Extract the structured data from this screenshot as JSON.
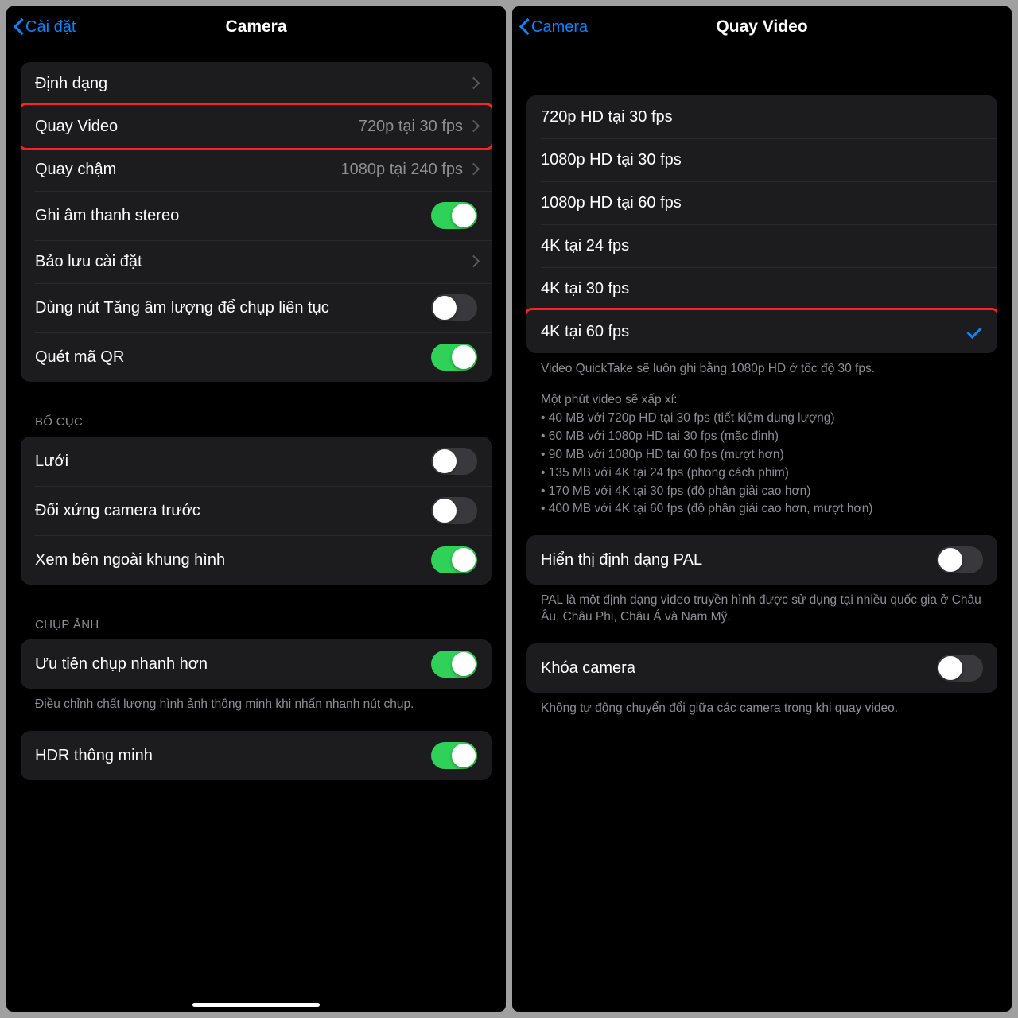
{
  "left": {
    "back": "Cài đặt",
    "title": "Camera",
    "rows": {
      "format": "Định dạng",
      "recordVideo": "Quay Video",
      "recordVideoDetail": "720p tại 30 fps",
      "slowMo": "Quay chậm",
      "slowMoDetail": "1080p tại 240 fps",
      "stereo": "Ghi âm thanh stereo",
      "preserve": "Bảo lưu cài đặt",
      "volumeBurst": "Dùng nút Tăng âm lượng để chụp liên tục",
      "qr": "Quét mã QR"
    },
    "compositionHeader": "BỐ CỤC",
    "composition": {
      "grid": "Lưới",
      "mirror": "Đối xứng camera trước",
      "outside": "Xem bên ngoài khung hình"
    },
    "captureHeader": "CHỤP ẢNH",
    "capture": {
      "fastShot": "Ưu tiên chụp nhanh hơn",
      "fastShotFooter": "Điều chỉnh chất lượng hình ảnh thông minh khi nhấn nhanh nút chụp.",
      "hdr": "HDR thông minh"
    }
  },
  "right": {
    "back": "Camera",
    "title": "Quay Video",
    "options": [
      "720p HD tại 30 fps",
      "1080p HD tại 30 fps",
      "1080p HD tại 60 fps",
      "4K tại 24 fps",
      "4K tại 30 fps",
      "4K tại 60 fps"
    ],
    "quicktake": "Video QuickTake sẽ luôn ghi bằng 1080p HD ở tốc độ 30 fps.",
    "approx": "Một phút video sẽ xấp xỉ:",
    "sizes": [
      "• 40 MB với 720p HD tại 30 fps (tiết kiệm dung lượng)",
      "• 60 MB với 1080p HD tại 30 fps (mặc định)",
      "• 90 MB với 1080p HD tại 60 fps (mượt hơn)",
      "• 135 MB với 4K tại 24 fps (phong cách phim)",
      "• 170 MB với 4K tại 30 fps (độ phân giải cao hơn)",
      "• 400 MB với 4K tại 60 fps (độ phân giải cao hơn, mượt hơn)"
    ],
    "pal": "Hiển thị định dạng PAL",
    "palFooter": "PAL là một định dạng video truyền hình được sử dụng tại nhiều quốc gia ở Châu Âu, Châu Phi, Châu Á và Nam Mỹ.",
    "lock": "Khóa camera",
    "lockFooter": "Không tự động chuyển đổi giữa các camera trong khi quay video."
  }
}
